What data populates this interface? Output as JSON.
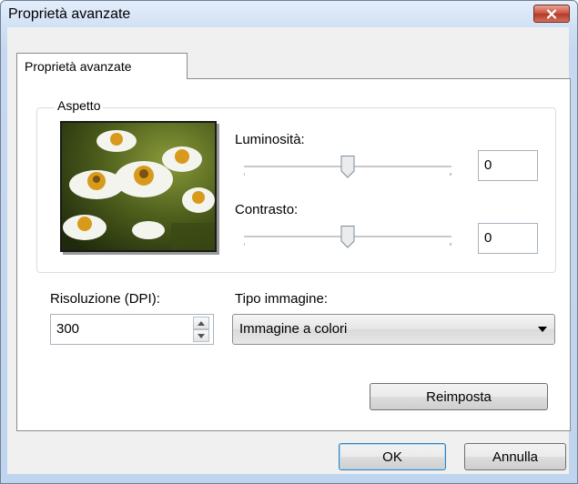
{
  "window": {
    "title": "Proprietà avanzate"
  },
  "tab": {
    "label": "Proprietà avanzate"
  },
  "appearance": {
    "group_label": "Aspetto",
    "brightness_label": "Luminosità:",
    "brightness_value": "0",
    "contrast_label": "Contrasto:",
    "contrast_value": "0"
  },
  "resolution": {
    "label": "Risoluzione (DPI):",
    "value": "300"
  },
  "image_type": {
    "label": "Tipo immagine:",
    "selected": "Immagine a colori"
  },
  "buttons": {
    "reset": "Reimposta",
    "ok": "OK",
    "cancel": "Annulla"
  }
}
